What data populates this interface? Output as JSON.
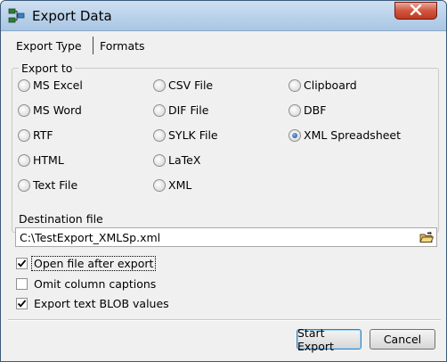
{
  "window": {
    "title": "Export Data",
    "icon": "export-data-icon"
  },
  "tabs": [
    {
      "label": "Export Type",
      "active": true
    },
    {
      "label": "Formats",
      "active": false
    }
  ],
  "export_group": {
    "label": "Export to",
    "options": [
      {
        "label": "MS Excel",
        "checked": false
      },
      {
        "label": "MS Word",
        "checked": false
      },
      {
        "label": "RTF",
        "checked": false
      },
      {
        "label": "HTML",
        "checked": false
      },
      {
        "label": "Text File",
        "checked": false
      },
      {
        "label": "CSV File",
        "checked": false
      },
      {
        "label": "DIF File",
        "checked": false
      },
      {
        "label": "SYLK File",
        "checked": false
      },
      {
        "label": "LaTeX",
        "checked": false
      },
      {
        "label": "XML",
        "checked": false
      },
      {
        "label": "Clipboard",
        "checked": false
      },
      {
        "label": "DBF",
        "checked": false
      },
      {
        "label": "XML Spreadsheet",
        "checked": true
      }
    ]
  },
  "destination": {
    "label": "Destination file",
    "value": "C:\\TestExport_XMLSp.xml"
  },
  "checkboxes": [
    {
      "label": "Open file after export",
      "checked": true
    },
    {
      "label": "Omit column captions",
      "checked": false
    },
    {
      "label": "Export text BLOB values",
      "checked": true
    }
  ],
  "buttons": {
    "start_export": "Start Export",
    "cancel": "Cancel"
  },
  "colors": {
    "titlebar": "#b9d1ea",
    "close_button": "#c0391f",
    "radio_checked": "#1b4f97",
    "dialog_background": "#f0f0f0"
  }
}
